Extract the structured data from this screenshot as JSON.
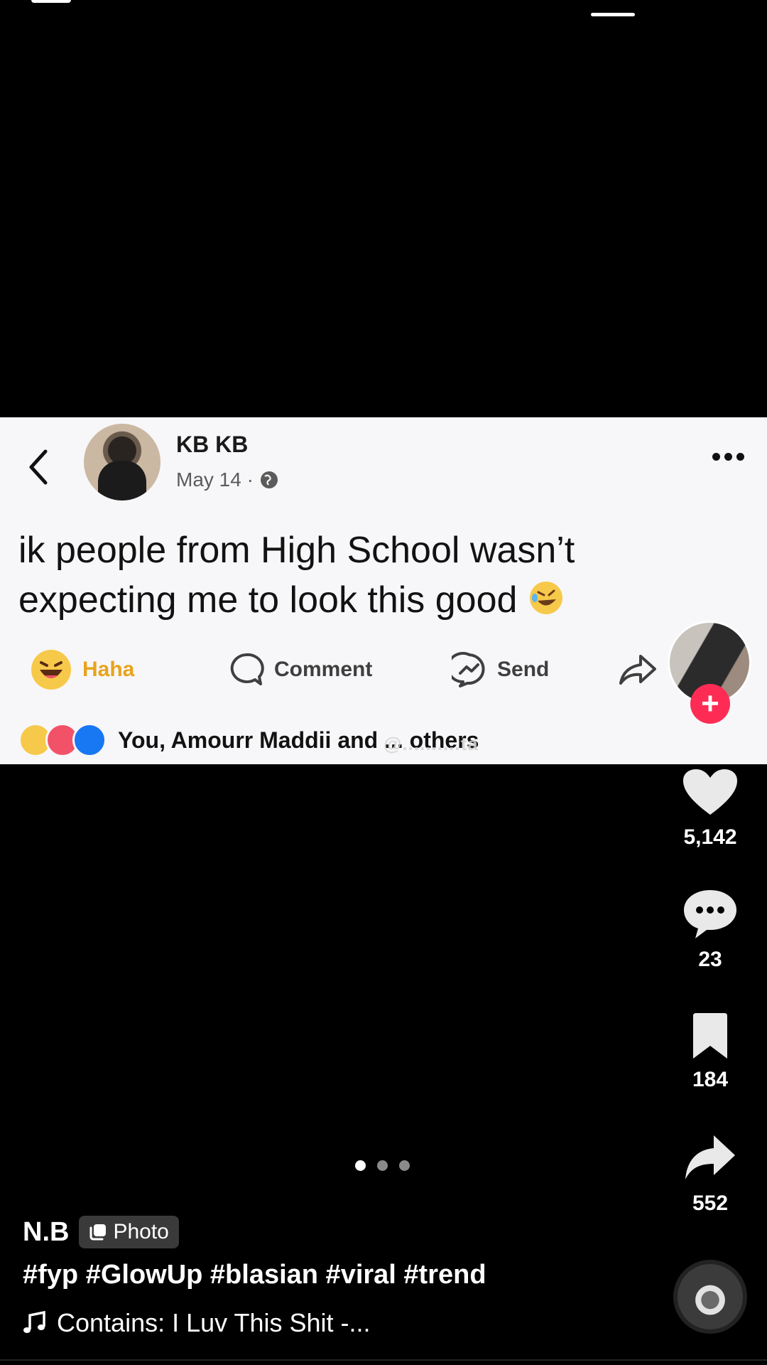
{
  "post": {
    "name": "KB KB",
    "date": "May 14 ·",
    "text": "ik people from High School wasn’t expecting me to look this good",
    "actions": {
      "haha": "Haha",
      "comment": "Comment",
      "send": "Send"
    },
    "reactions_text": "You, Amourr Maddii and ... others"
  },
  "watermark": "@..........ta",
  "rail": {
    "likes": "5,142",
    "comments": "23",
    "saves": "184",
    "shares": "552"
  },
  "caption": {
    "author": "N.B",
    "badge": "Photo",
    "hashtags": "#fyp #GlowUp #blasian #viral #trend",
    "music": "Contains: I Luv This Shit -..."
  },
  "carousel": {
    "count": 3,
    "active": 1
  },
  "colors": {
    "follow": "#fe2c55",
    "haha": "#e8a31c",
    "like": "#1877f2"
  }
}
